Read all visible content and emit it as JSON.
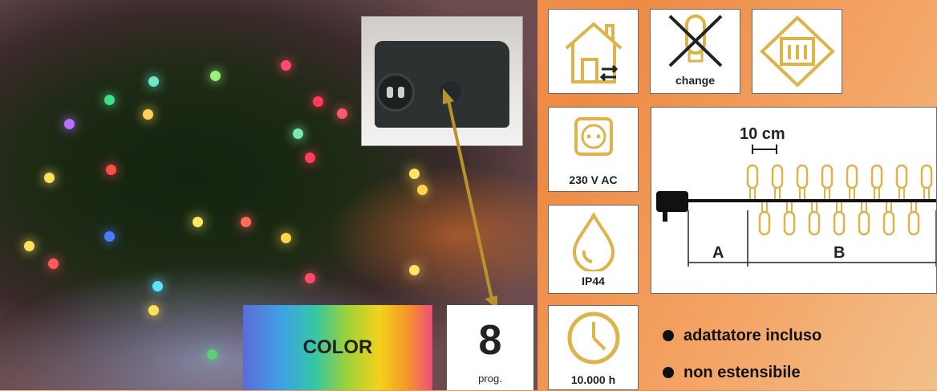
{
  "colors": {
    "gold": "#deb34a",
    "background": "#f29a5a",
    "text": "#222222"
  },
  "product_photo": {
    "icon": "led-string-lights-photo",
    "inset_icon": "power-adapter-photo"
  },
  "color_box": {
    "label": "COLOR"
  },
  "programs": {
    "number": "8",
    "label": "prog."
  },
  "icons": {
    "indoor_outdoor": {
      "icon": "house-indoor-outdoor-icon"
    },
    "change": {
      "icon": "no-bulb-change-icon",
      "label": "change"
    },
    "class": {
      "icon": "protection-class-iii-icon"
    },
    "voltage": {
      "icon": "power-socket-icon",
      "label": "230 V AC"
    },
    "ip": {
      "icon": "water-drop-icon",
      "label": "IP44"
    },
    "timer": {
      "icon": "clock-icon",
      "label": "10.000 h"
    }
  },
  "diagram": {
    "spacing_label": "10 cm",
    "label_a": "A",
    "label_b": "B"
  },
  "features": [
    {
      "text": "adattatore incluso"
    },
    {
      "text": "non estensibile"
    }
  ]
}
